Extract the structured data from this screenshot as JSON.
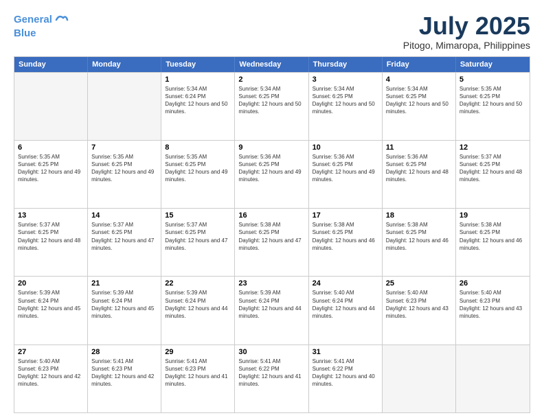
{
  "header": {
    "logo_line1": "General",
    "logo_line2": "Blue",
    "month": "July 2025",
    "location": "Pitogo, Mimaropa, Philippines"
  },
  "days_of_week": [
    "Sunday",
    "Monday",
    "Tuesday",
    "Wednesday",
    "Thursday",
    "Friday",
    "Saturday"
  ],
  "weeks": [
    [
      {
        "day": null,
        "empty": true
      },
      {
        "day": null,
        "empty": true
      },
      {
        "day": "1",
        "sunrise": "Sunrise: 5:34 AM",
        "sunset": "Sunset: 6:24 PM",
        "daylight": "Daylight: 12 hours and 50 minutes."
      },
      {
        "day": "2",
        "sunrise": "Sunrise: 5:34 AM",
        "sunset": "Sunset: 6:25 PM",
        "daylight": "Daylight: 12 hours and 50 minutes."
      },
      {
        "day": "3",
        "sunrise": "Sunrise: 5:34 AM",
        "sunset": "Sunset: 6:25 PM",
        "daylight": "Daylight: 12 hours and 50 minutes."
      },
      {
        "day": "4",
        "sunrise": "Sunrise: 5:34 AM",
        "sunset": "Sunset: 6:25 PM",
        "daylight": "Daylight: 12 hours and 50 minutes."
      },
      {
        "day": "5",
        "sunrise": "Sunrise: 5:35 AM",
        "sunset": "Sunset: 6:25 PM",
        "daylight": "Daylight: 12 hours and 50 minutes."
      }
    ],
    [
      {
        "day": "6",
        "sunrise": "Sunrise: 5:35 AM",
        "sunset": "Sunset: 6:25 PM",
        "daylight": "Daylight: 12 hours and 49 minutes."
      },
      {
        "day": "7",
        "sunrise": "Sunrise: 5:35 AM",
        "sunset": "Sunset: 6:25 PM",
        "daylight": "Daylight: 12 hours and 49 minutes."
      },
      {
        "day": "8",
        "sunrise": "Sunrise: 5:35 AM",
        "sunset": "Sunset: 6:25 PM",
        "daylight": "Daylight: 12 hours and 49 minutes."
      },
      {
        "day": "9",
        "sunrise": "Sunrise: 5:36 AM",
        "sunset": "Sunset: 6:25 PM",
        "daylight": "Daylight: 12 hours and 49 minutes."
      },
      {
        "day": "10",
        "sunrise": "Sunrise: 5:36 AM",
        "sunset": "Sunset: 6:25 PM",
        "daylight": "Daylight: 12 hours and 49 minutes."
      },
      {
        "day": "11",
        "sunrise": "Sunrise: 5:36 AM",
        "sunset": "Sunset: 6:25 PM",
        "daylight": "Daylight: 12 hours and 48 minutes."
      },
      {
        "day": "12",
        "sunrise": "Sunrise: 5:37 AM",
        "sunset": "Sunset: 6:25 PM",
        "daylight": "Daylight: 12 hours and 48 minutes."
      }
    ],
    [
      {
        "day": "13",
        "sunrise": "Sunrise: 5:37 AM",
        "sunset": "Sunset: 6:25 PM",
        "daylight": "Daylight: 12 hours and 48 minutes."
      },
      {
        "day": "14",
        "sunrise": "Sunrise: 5:37 AM",
        "sunset": "Sunset: 6:25 PM",
        "daylight": "Daylight: 12 hours and 47 minutes."
      },
      {
        "day": "15",
        "sunrise": "Sunrise: 5:37 AM",
        "sunset": "Sunset: 6:25 PM",
        "daylight": "Daylight: 12 hours and 47 minutes."
      },
      {
        "day": "16",
        "sunrise": "Sunrise: 5:38 AM",
        "sunset": "Sunset: 6:25 PM",
        "daylight": "Daylight: 12 hours and 47 minutes."
      },
      {
        "day": "17",
        "sunrise": "Sunrise: 5:38 AM",
        "sunset": "Sunset: 6:25 PM",
        "daylight": "Daylight: 12 hours and 46 minutes."
      },
      {
        "day": "18",
        "sunrise": "Sunrise: 5:38 AM",
        "sunset": "Sunset: 6:25 PM",
        "daylight": "Daylight: 12 hours and 46 minutes."
      },
      {
        "day": "19",
        "sunrise": "Sunrise: 5:38 AM",
        "sunset": "Sunset: 6:25 PM",
        "daylight": "Daylight: 12 hours and 46 minutes."
      }
    ],
    [
      {
        "day": "20",
        "sunrise": "Sunrise: 5:39 AM",
        "sunset": "Sunset: 6:24 PM",
        "daylight": "Daylight: 12 hours and 45 minutes."
      },
      {
        "day": "21",
        "sunrise": "Sunrise: 5:39 AM",
        "sunset": "Sunset: 6:24 PM",
        "daylight": "Daylight: 12 hours and 45 minutes."
      },
      {
        "day": "22",
        "sunrise": "Sunrise: 5:39 AM",
        "sunset": "Sunset: 6:24 PM",
        "daylight": "Daylight: 12 hours and 44 minutes."
      },
      {
        "day": "23",
        "sunrise": "Sunrise: 5:39 AM",
        "sunset": "Sunset: 6:24 PM",
        "daylight": "Daylight: 12 hours and 44 minutes."
      },
      {
        "day": "24",
        "sunrise": "Sunrise: 5:40 AM",
        "sunset": "Sunset: 6:24 PM",
        "daylight": "Daylight: 12 hours and 44 minutes."
      },
      {
        "day": "25",
        "sunrise": "Sunrise: 5:40 AM",
        "sunset": "Sunset: 6:23 PM",
        "daylight": "Daylight: 12 hours and 43 minutes."
      },
      {
        "day": "26",
        "sunrise": "Sunrise: 5:40 AM",
        "sunset": "Sunset: 6:23 PM",
        "daylight": "Daylight: 12 hours and 43 minutes."
      }
    ],
    [
      {
        "day": "27",
        "sunrise": "Sunrise: 5:40 AM",
        "sunset": "Sunset: 6:23 PM",
        "daylight": "Daylight: 12 hours and 42 minutes."
      },
      {
        "day": "28",
        "sunrise": "Sunrise: 5:41 AM",
        "sunset": "Sunset: 6:23 PM",
        "daylight": "Daylight: 12 hours and 42 minutes."
      },
      {
        "day": "29",
        "sunrise": "Sunrise: 5:41 AM",
        "sunset": "Sunset: 6:23 PM",
        "daylight": "Daylight: 12 hours and 41 minutes."
      },
      {
        "day": "30",
        "sunrise": "Sunrise: 5:41 AM",
        "sunset": "Sunset: 6:22 PM",
        "daylight": "Daylight: 12 hours and 41 minutes."
      },
      {
        "day": "31",
        "sunrise": "Sunrise: 5:41 AM",
        "sunset": "Sunset: 6:22 PM",
        "daylight": "Daylight: 12 hours and 40 minutes."
      },
      {
        "day": null,
        "empty": true
      },
      {
        "day": null,
        "empty": true
      }
    ]
  ]
}
